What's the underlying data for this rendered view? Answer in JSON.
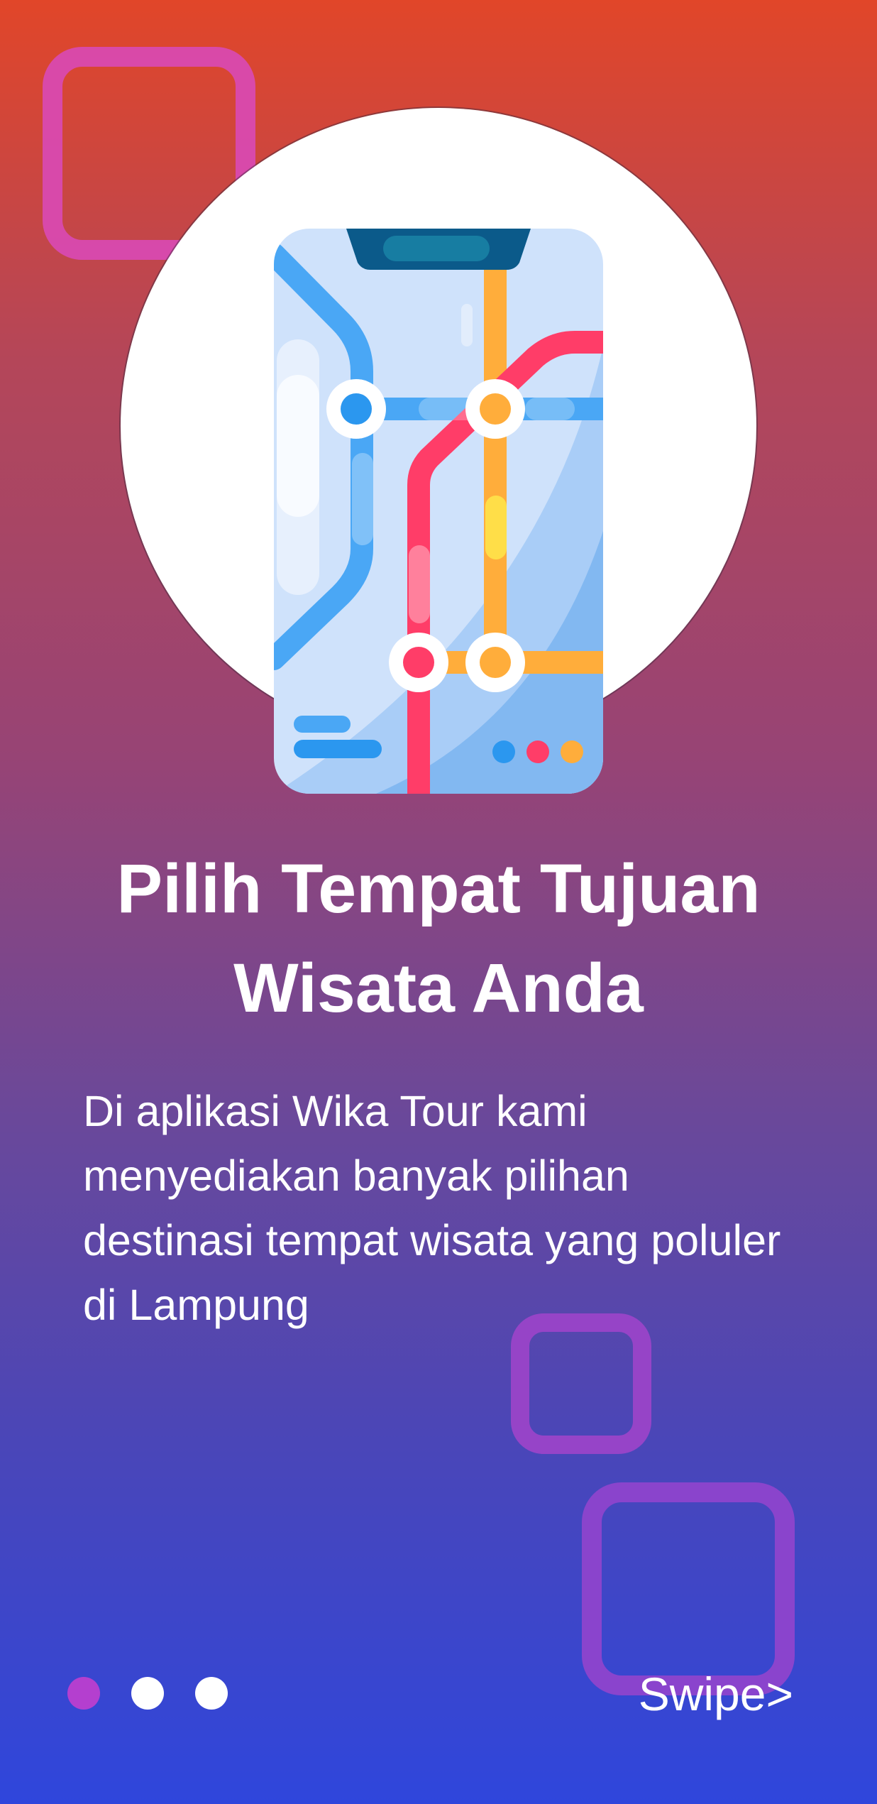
{
  "onboarding": {
    "title": "Pilih Tempat Tujuan Wisata Anda",
    "description": "Di aplikasi Wika Tour kami menyediakan banyak pilihan destinasi tempat wisata yang poluler di Lampung",
    "swipe_label": "Swipe>",
    "pagination": {
      "total": 3,
      "active": 1
    }
  },
  "colors": {
    "accent_active_dot": "#b43fcf",
    "inactive_dot": "#ffffff",
    "route_blue": "#4aa7f5",
    "route_orange": "#ffad3b",
    "route_red": "#ff3d68"
  },
  "illustration": {
    "icon": "transit-map-phone-icon"
  }
}
